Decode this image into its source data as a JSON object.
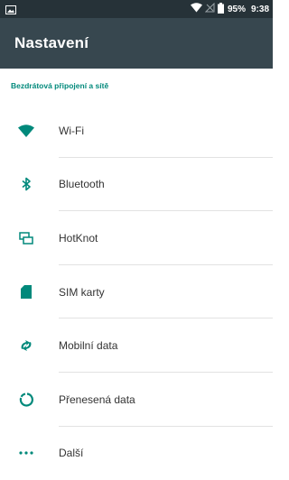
{
  "colors": {
    "status_bar": "#263238",
    "app_bar": "#37474f",
    "accent": "#00897b",
    "text": "#333333"
  },
  "status_bar": {
    "left_icon": "image-notification-icon",
    "icons": [
      "wifi-icon",
      "no-sim-signal-icon",
      "battery-icon"
    ],
    "battery": "95%",
    "time": "9:38"
  },
  "app_bar": {
    "title": "Nastavení"
  },
  "section": {
    "title": "Bezdrátová připojení a sítě"
  },
  "items": [
    {
      "label": "Wi-Fi",
      "icon": "wifi-icon"
    },
    {
      "label": "Bluetooth",
      "icon": "bluetooth-icon"
    },
    {
      "label": "HotKnot",
      "icon": "hotknot-icon"
    },
    {
      "label": "SIM karty",
      "icon": "sim-card-icon"
    },
    {
      "label": "Mobilní data",
      "icon": "mobile-data-icon"
    },
    {
      "label": "Přenesená data",
      "icon": "data-usage-icon"
    },
    {
      "label": "Další",
      "icon": "more-icon"
    }
  ]
}
